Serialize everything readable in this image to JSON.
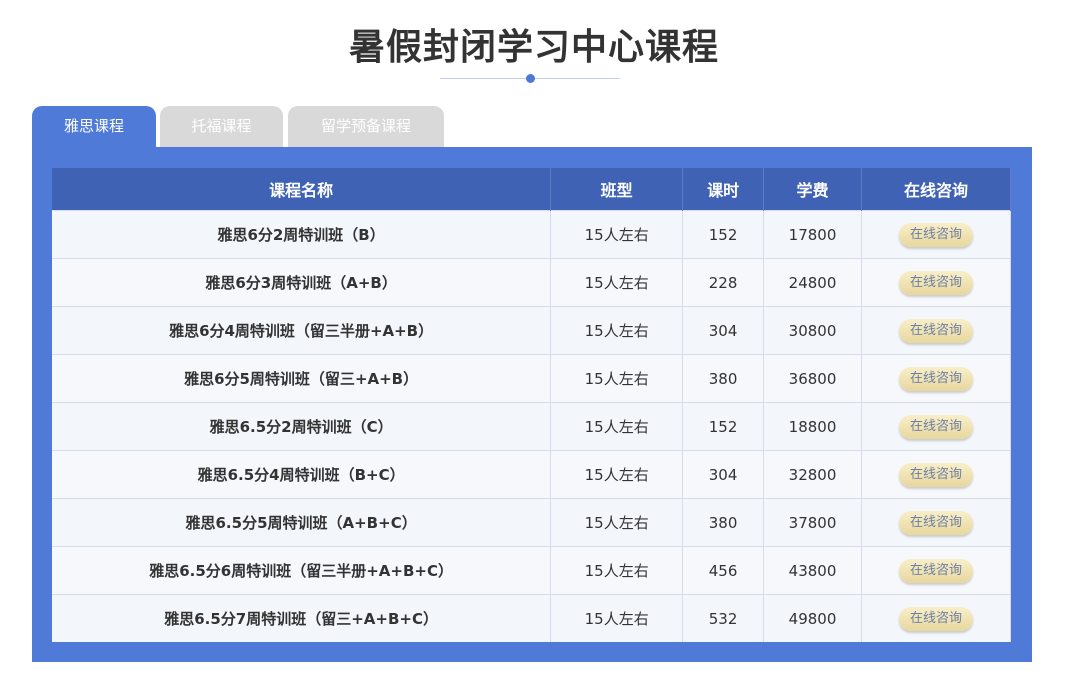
{
  "page": {
    "title": "暑假封闭学习中心课程"
  },
  "tabs": [
    {
      "label": "雅思课程",
      "active": true
    },
    {
      "label": "托福课程",
      "active": false
    },
    {
      "label": "留学预备课程",
      "active": false
    }
  ],
  "table": {
    "headers": [
      "课程名称",
      "班型",
      "课时",
      "学费",
      "在线咨询"
    ],
    "rows": [
      {
        "name": "雅思6分2周特训班（B）",
        "size": "15人左右",
        "hours": "152",
        "fee": "17800",
        "action": "在线咨询"
      },
      {
        "name": "雅思6分3周特训班（A+B）",
        "size": "15人左右",
        "hours": "228",
        "fee": "24800",
        "action": "在线咨询"
      },
      {
        "name": "雅思6分4周特训班（留三半册+A+B）",
        "size": "15人左右",
        "hours": "304",
        "fee": "30800",
        "action": "在线咨询"
      },
      {
        "name": "雅思6分5周特训班（留三+A+B）",
        "size": "15人左右",
        "hours": "380",
        "fee": "36800",
        "action": "在线咨询"
      },
      {
        "name": "雅思6.5分2周特训班（C）",
        "size": "15人左右",
        "hours": "152",
        "fee": "18800",
        "action": "在线咨询"
      },
      {
        "name": "雅思6.5分4周特训班（B+C）",
        "size": "15人左右",
        "hours": "304",
        "fee": "32800",
        "action": "在线咨询"
      },
      {
        "name": "雅思6.5分5周特训班（A+B+C）",
        "size": "15人左右",
        "hours": "380",
        "fee": "37800",
        "action": "在线咨询"
      },
      {
        "name": "雅思6.5分6周特训班（留三半册+A+B+C）",
        "size": "15人左右",
        "hours": "456",
        "fee": "43800",
        "action": "在线咨询"
      },
      {
        "name": "雅思6.5分7周特训班（留三+A+B+C）",
        "size": "15人左右",
        "hours": "532",
        "fee": "49800",
        "action": "在线咨询"
      }
    ]
  },
  "colors": {
    "accent": "#4f7ad7",
    "header": "#3f62b4",
    "button": "#efe2b0"
  }
}
